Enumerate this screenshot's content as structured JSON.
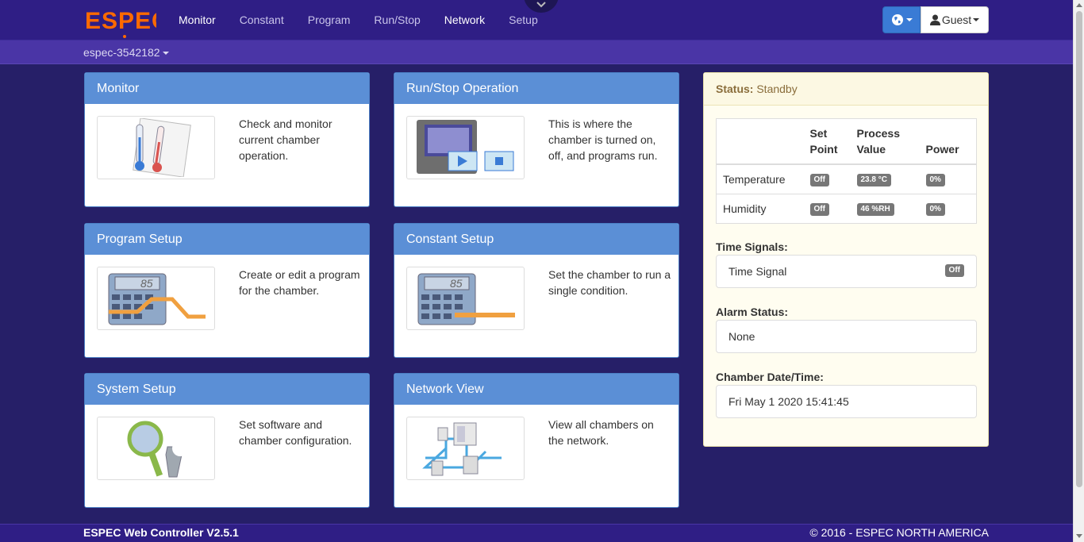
{
  "brand": {
    "logo_text": "ESPEC",
    "logo_color": "#ff6a00"
  },
  "nav": {
    "items": [
      {
        "label": "Monitor"
      },
      {
        "label": "Constant"
      },
      {
        "label": "Program"
      },
      {
        "label": "Run/Stop"
      },
      {
        "label": "Network"
      },
      {
        "label": "Setup"
      }
    ],
    "user_label": "Guest",
    "globe_icon": "globe-icon",
    "collapse_icon": "chevron-down-icon"
  },
  "device": {
    "name": "espec-3542182"
  },
  "cards": [
    {
      "title": "Monitor",
      "text": "Check and monitor current chamber operation.",
      "icon": "thermometer-icon"
    },
    {
      "title": "Run/Stop Operation",
      "text": "This is where the chamber is turned on, off, and programs run.",
      "icon": "controller-play-stop-icon"
    },
    {
      "title": "Program Setup",
      "text": "Create or edit a program for the chamber.",
      "icon": "calculator-program-icon"
    },
    {
      "title": "Constant Setup",
      "text": "Set the chamber to run a single condition.",
      "icon": "calculator-constant-icon"
    },
    {
      "title": "System Setup",
      "text": "Set software and chamber configuration.",
      "icon": "magnifier-wrench-icon"
    },
    {
      "title": "Network View",
      "text": "View all chambers on the network.",
      "icon": "network-chambers-icon"
    }
  ],
  "status": {
    "label": "Status:",
    "value": "Standby",
    "table": {
      "headers": [
        "",
        "Set Point",
        "Process Value",
        "Power"
      ],
      "rows": [
        {
          "name": "Temperature",
          "set_point": "Off",
          "process_value": "23.8 °C",
          "power": "0%"
        },
        {
          "name": "Humidity",
          "set_point": "Off",
          "process_value": "46 %RH",
          "power": "0%"
        }
      ]
    },
    "time_signals_label": "Time Signals:",
    "time_signal_name": "Time Signal",
    "time_signal_state": "Off",
    "alarm_label": "Alarm Status:",
    "alarm_value": "None",
    "datetime_label": "Chamber Date/Time:",
    "datetime_value": "Fri May 1 2020 15:41:45"
  },
  "footer": {
    "left": "ESPEC Web Controller V2.5.1",
    "right": "© 2016 - ESPEC NORTH AMERICA"
  }
}
